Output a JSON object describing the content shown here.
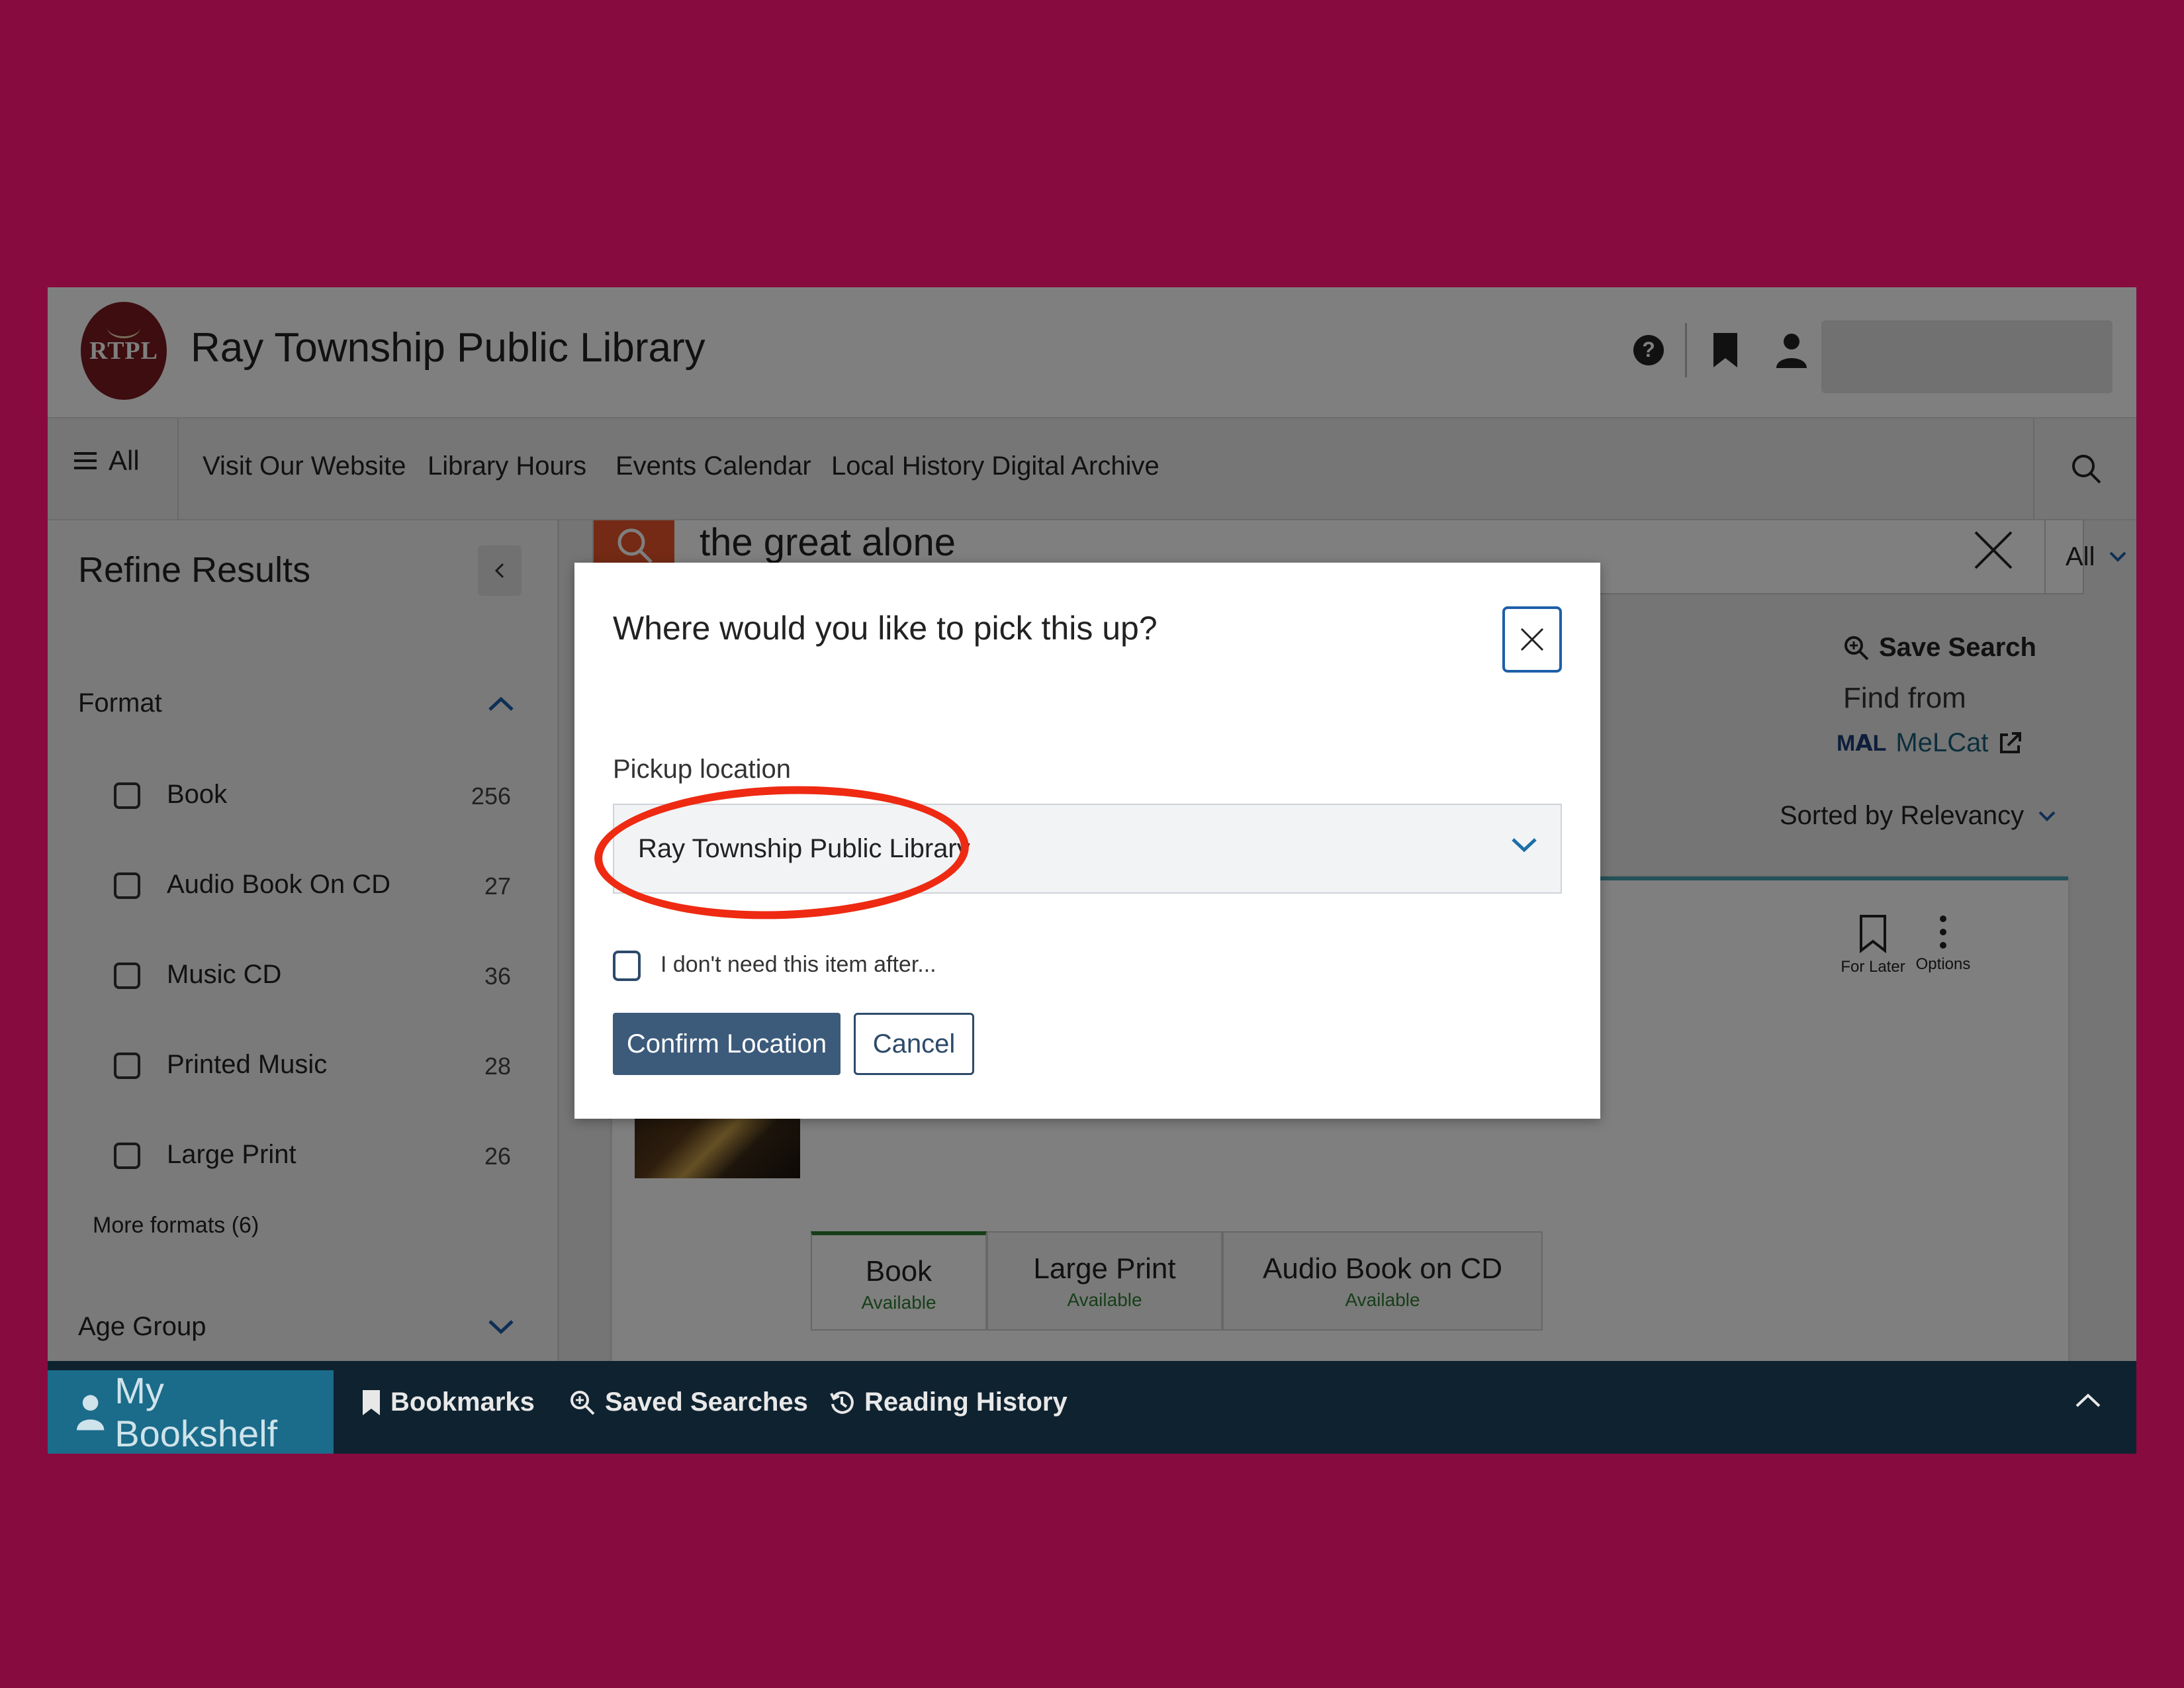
{
  "header": {
    "logo_text": "RTPL",
    "title": "Ray Township Public Library",
    "icons": [
      "help-icon",
      "bookmark-icon",
      "user-icon"
    ]
  },
  "nav": {
    "all_label": "All",
    "items": [
      "Visit Our Website",
      "Library Hours",
      "Events Calendar",
      "Local History Digital Archive"
    ]
  },
  "sidebar": {
    "title": "Refine Results",
    "format_heading": "Format",
    "formats": [
      {
        "label": "Book",
        "count": "256"
      },
      {
        "label": "Audio Book On CD",
        "count": "27"
      },
      {
        "label": "Music CD",
        "count": "36"
      },
      {
        "label": "Printed Music",
        "count": "28"
      },
      {
        "label": "Large Print",
        "count": "26"
      }
    ],
    "more_formats": "More formats (6)",
    "age_group_heading": "Age Group"
  },
  "search": {
    "query": "the great alone",
    "scope": "All"
  },
  "results": {
    "save_search": "Save Search",
    "find_from": "Find from",
    "melcat": "MeLCat",
    "sorted": "Sorted by Relevancy",
    "for_later": "For Later",
    "options": "Options",
    "format_tabs": [
      {
        "title": "Book",
        "status": "Available"
      },
      {
        "title": "Large Print",
        "status": "Available"
      },
      {
        "title": "Audio Book on CD",
        "status": "Available"
      }
    ]
  },
  "modal": {
    "title": "Where would you like to pick this up?",
    "pickup_label": "Pickup location",
    "pickup_value": "Ray Township Public Library",
    "checkbox_label": "I don't need this item after...",
    "confirm": "Confirm Location",
    "cancel": "Cancel",
    "highlight_color": "#ee2a12"
  },
  "bottom_bar": {
    "active": "My Bookshelf",
    "items": [
      "Bookmarks",
      "Saved Searches",
      "Reading History"
    ]
  },
  "colors": {
    "background": "#870b3f",
    "primary_button": "#3c5a7a",
    "bottom_bar": "#0f2230",
    "bookshelf_tab": "#1b6b8a"
  }
}
